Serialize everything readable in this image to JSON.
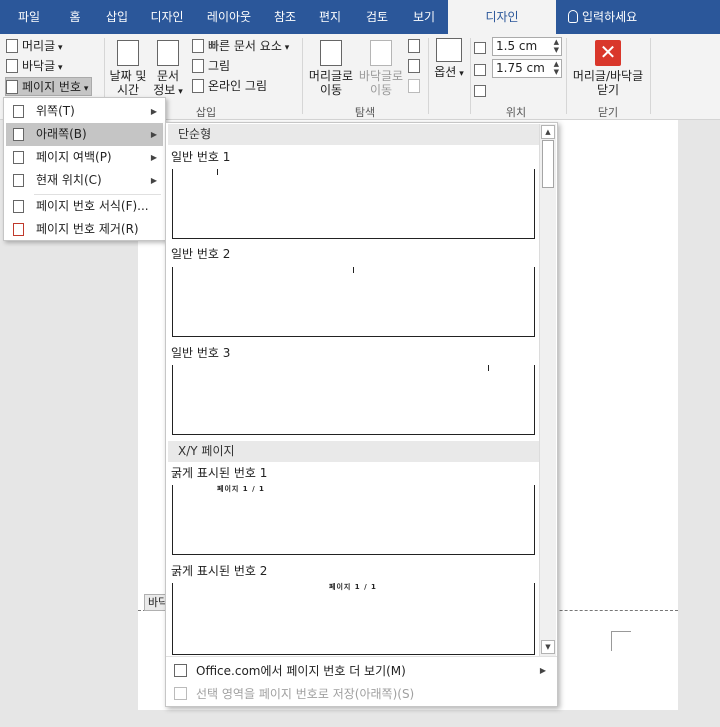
{
  "tabs": [
    {
      "label": "파일",
      "active": false
    },
    {
      "label": "홈",
      "active": false
    },
    {
      "label": "삽입",
      "active": false
    },
    {
      "label": "디자인",
      "active": false
    },
    {
      "label": "레이아웃",
      "active": false
    },
    {
      "label": "참조",
      "active": false
    },
    {
      "label": "편지",
      "active": false
    },
    {
      "label": "검토",
      "active": false
    },
    {
      "label": "보기",
      "active": false
    },
    {
      "label": "디자인",
      "active": true
    }
  ],
  "search": {
    "label": "입력하세요"
  },
  "ribbon": {
    "header_footer": {
      "header": "머리글",
      "footer": "바닥글",
      "page_number": "페이지 번호"
    },
    "insert": {
      "datetime": "날짜 및 시간",
      "docinfo": "문서 정보",
      "quick_parts": "빠른 문서 요소",
      "picture": "그림",
      "online_picture": "온라인 그림",
      "group_label": "삽입"
    },
    "navigate": {
      "goto_header": "머리글로 이동",
      "goto_footer": "바닥글로 이동",
      "group_label": "탐색"
    },
    "options": {
      "label": "옵션"
    },
    "position": {
      "header_pos": "1.5 cm",
      "footer_pos": "1.75 cm",
      "group_label": "위치"
    },
    "close": {
      "label": "머리글/바닥글 닫기",
      "group_label": "닫기"
    }
  },
  "menu": {
    "items": [
      {
        "label": "위쪽(T)",
        "has_sub": true,
        "highlighted": false
      },
      {
        "label": "아래쪽(B)",
        "has_sub": true,
        "highlighted": true
      },
      {
        "label": "페이지 여백(P)",
        "has_sub": true,
        "highlighted": false
      },
      {
        "label": "현재 위치(C)",
        "has_sub": true,
        "highlighted": false
      },
      {
        "label": "페이지 번호 서식(F)...",
        "has_sub": false,
        "highlighted": false
      },
      {
        "label": "페이지 번호 제거(R)",
        "has_sub": false,
        "highlighted": false
      }
    ]
  },
  "gallery": {
    "section_simple": "단순형",
    "items_simple": [
      "일반 번호 1",
      "일반 번호 2",
      "일반 번호 3"
    ],
    "section_xy": "X/Y 페이지",
    "items_xy": [
      "굵게 표시된 번호 1",
      "굵게 표시된 번호 2"
    ],
    "thumb_text": "페이지 1 / 1",
    "more": "Office.com에서 페이지 번호 더 보기(M)",
    "save_selection": "선택 영역을 페이지 번호로 저장(아래쪽)(S)"
  },
  "document": {
    "footer_tag": "바닥"
  }
}
